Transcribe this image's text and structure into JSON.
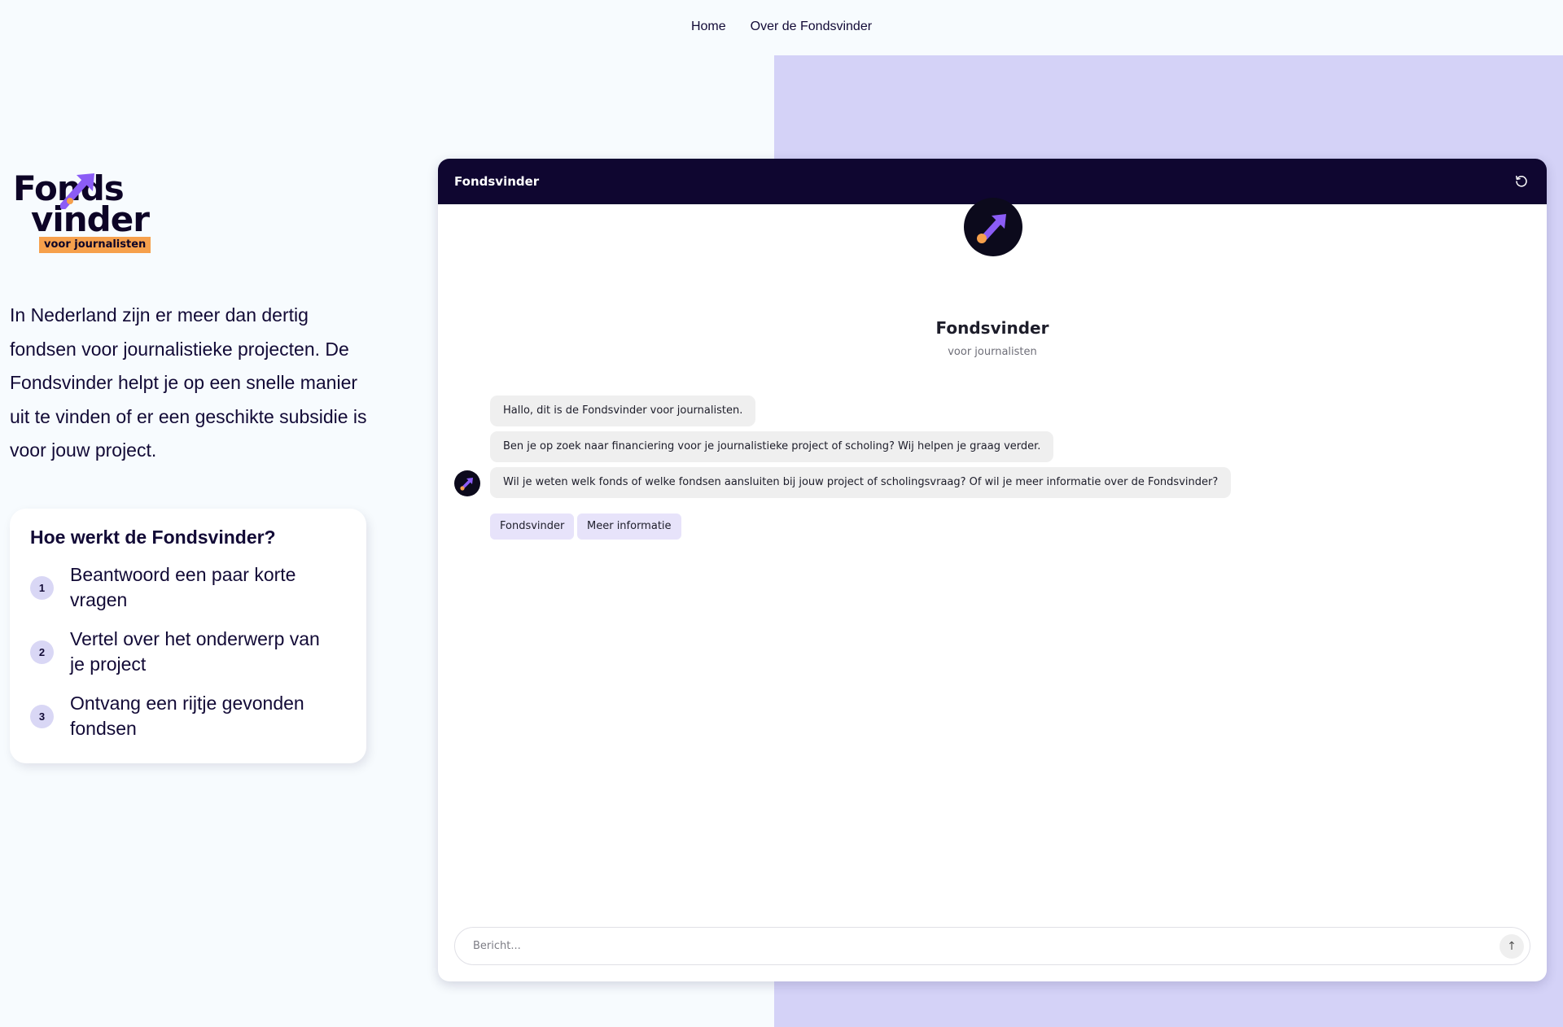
{
  "nav": {
    "home": "Home",
    "about": "Over de Fondsvinder"
  },
  "logo": {
    "line1": "Fonds",
    "line2": "vinder",
    "tagline": "voor journalisten"
  },
  "intro": "In Nederland zijn er meer dan dertig fondsen voor journalistieke projecten. De Fondsvinder helpt je op een snelle manier uit te vinden of er een geschikte subsidie is voor jouw project.",
  "how": {
    "title": "Hoe werkt de Fondsvinder?",
    "steps": [
      {
        "num": "1",
        "text": "Beantwoord een paar korte vragen"
      },
      {
        "num": "2",
        "text": "Vertel over het onderwerp van je project"
      },
      {
        "num": "3",
        "text": "Ontvang een rijtje gevonden fondsen"
      }
    ]
  },
  "chat": {
    "title": "Fondsvinder",
    "bot_name": "Fondsvinder",
    "bot_subtitle": "voor journalisten",
    "messages": [
      "Hallo, dit is de Fondsvinder voor journalisten.",
      "Ben je op zoek naar financiering voor je journalistieke project of scholing? Wij helpen je graag verder.",
      "Wil je weten welk fonds of welke fondsen aansluiten bij jouw project of scholingsvraag? Of wil je meer informatie over de Fondsvinder?"
    ],
    "chips": [
      "Fondsvinder",
      "Meer informatie"
    ],
    "input_placeholder": "Bericht...",
    "send_glyph": "↑"
  },
  "colors": {
    "page_bg": "#f7fbfe",
    "lavender": "#d4d2f7",
    "header_navy": "#0f0630",
    "accent_purple": "#8b5cf6",
    "accent_orange": "#f6a04c"
  }
}
